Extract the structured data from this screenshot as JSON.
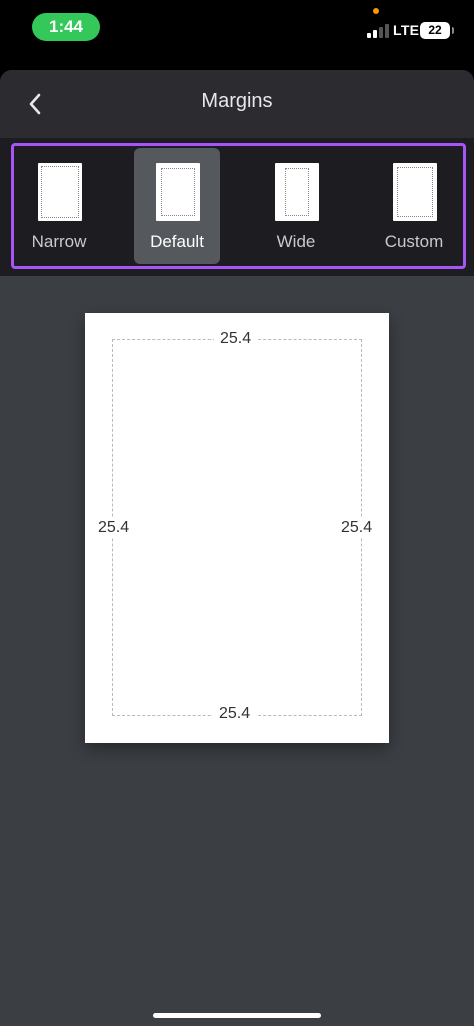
{
  "status_bar": {
    "time": "1:44",
    "network": "LTE",
    "battery": "22"
  },
  "header": {
    "title": "Margins",
    "back_icon": "chevron-left-icon"
  },
  "margin_options": [
    {
      "label": "Narrow",
      "selected": false
    },
    {
      "label": "Default",
      "selected": true
    },
    {
      "label": "Wide",
      "selected": false
    },
    {
      "label": "Custom",
      "selected": false
    }
  ],
  "preview": {
    "top": "25.4",
    "left": "25.4",
    "right": "25.4",
    "bottom": "25.4"
  },
  "colors": {
    "highlight": "#a855f7",
    "time_pill": "#34c759"
  }
}
